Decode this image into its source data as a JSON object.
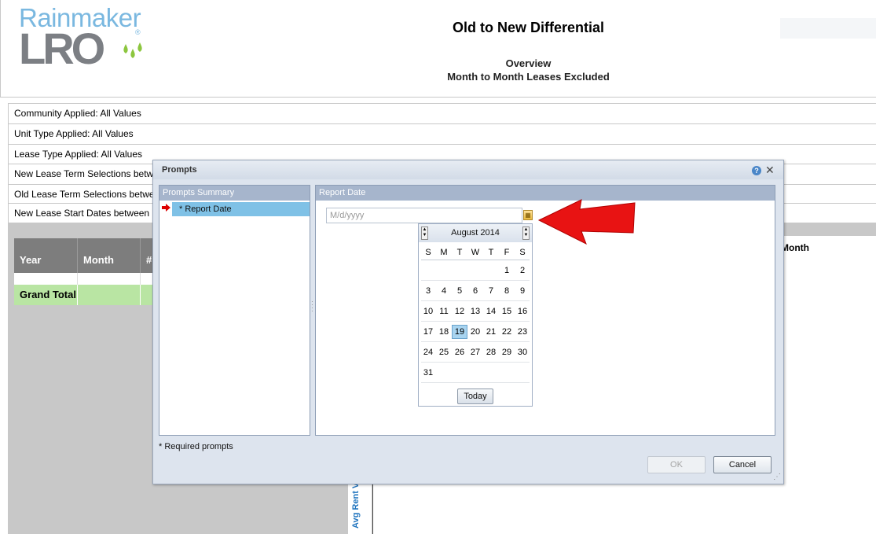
{
  "logo": {
    "top_text": "Rainmaker",
    "main_text": "LRO",
    "registered": "®"
  },
  "report": {
    "title": "Old to New Differential",
    "subtitle1": "Overview",
    "subtitle2": "Month to Month Leases Excluded"
  },
  "filters": [
    {
      "label": "Community Applied: All Values"
    },
    {
      "label": "Unit Type Applied: All Values"
    },
    {
      "label": "Lease Type Applied: All Values"
    },
    {
      "label": "New Lease Term Selections betw"
    },
    {
      "label": "Old Lease Term Selections betwe"
    },
    {
      "label": "New Lease Start Dates between"
    }
  ],
  "table": {
    "headers": [
      "Year",
      "Month",
      "#"
    ],
    "grand_total_label": "Grand Total"
  },
  "report_labels": {
    "month": "Month",
    "avg_rent": "Avg Rent V"
  },
  "dialog": {
    "title": "Prompts",
    "help_icon": "?",
    "close_icon": "✕",
    "summary_header": "Prompts Summary",
    "summary_item": "* Report Date",
    "date_header": "Report Date",
    "date_input_value": "",
    "date_input_placeholder": "M/d/yyyy",
    "required_note": "* Required prompts",
    "ok_label": "OK",
    "cancel_label": "Cancel"
  },
  "calendar": {
    "month_label": "August 2014",
    "days_of_week": [
      "S",
      "M",
      "T",
      "W",
      "T",
      "F",
      "S"
    ],
    "first_weekday": 5,
    "days_in_month": 31,
    "selected_day": 19,
    "today_label": "Today"
  },
  "colors": {
    "table_header": "#7d7d7d",
    "grand_total": "#b9e5a3",
    "dialog_panel_header": "#a6b5cc",
    "summary_selected": "#7fc1e6",
    "arrow": "#e81313"
  }
}
